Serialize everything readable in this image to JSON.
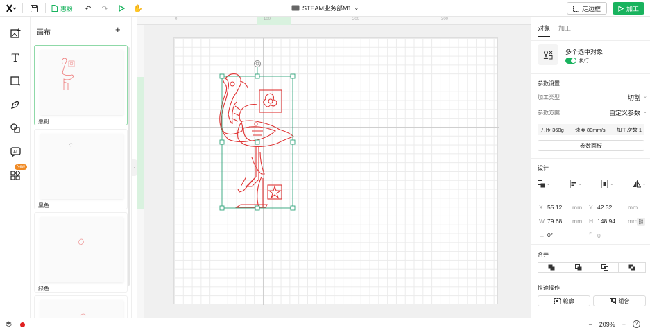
{
  "toolbar": {
    "file_name": "惠粉",
    "project_title": "STEAM业务部M1",
    "frame_label": "走边框",
    "process_label": "加工"
  },
  "layers": {
    "title": "画布",
    "items": [
      {
        "label": "惠粉"
      },
      {
        "label": "黑色"
      },
      {
        "label": "绿色"
      }
    ]
  },
  "rail": {
    "new_badge": "New"
  },
  "ruler": {
    "ticks": [
      "0",
      "100",
      "200",
      "300"
    ]
  },
  "props": {
    "tab_object": "对象",
    "tab_process": "加工",
    "selection_title": "多个选中对象",
    "execute_label": "执行",
    "param_section": "参数设置",
    "process_type_label": "加工类型",
    "process_type_value": "切割",
    "param_scheme_label": "参数方案",
    "param_scheme_value": "自定义参数",
    "pressure": "刀压 360g",
    "speed": "速度 80mm/s",
    "passes": "加工次数 1",
    "param_panel_button": "参数面板",
    "design_section": "设计",
    "x_label": "X",
    "x_value": "55.12",
    "x_unit": "mm",
    "y_label": "Y",
    "y_value": "42.32",
    "y_unit": "mm",
    "w_label": "W",
    "w_value": "79.68",
    "w_unit": "mm",
    "h_label": "H",
    "h_value": "148.94",
    "h_unit": "mm",
    "rotate_value": "0°",
    "corner_value": "0",
    "merge_section": "合并",
    "quick_section": "快速操作",
    "outline_button": "轮廓",
    "group_button": "组合"
  },
  "status": {
    "zoom": "209%"
  },
  "colors": {
    "accent": "#19b35e",
    "path": "#e03535",
    "selection": "#2fa37a"
  }
}
